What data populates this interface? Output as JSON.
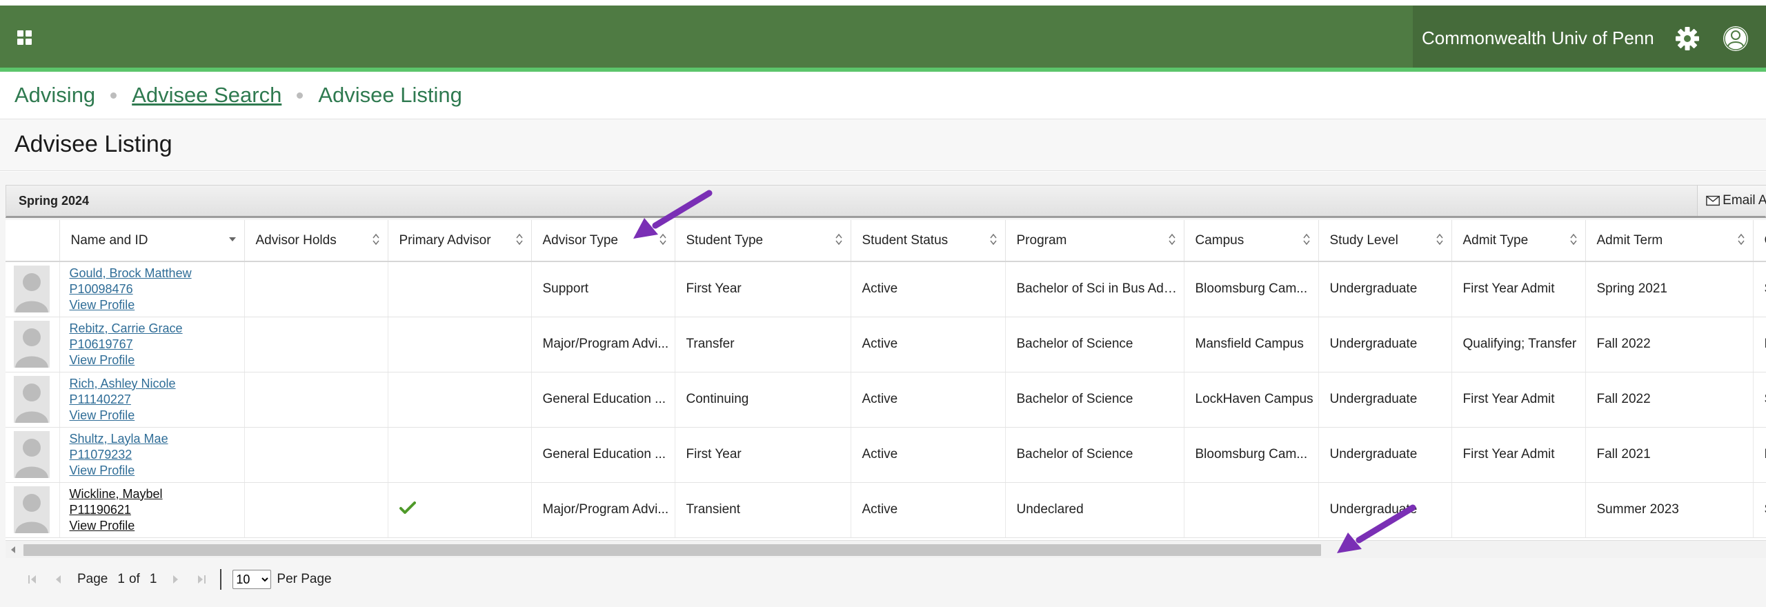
{
  "header": {
    "institution": "Commonwealth Univ of Penn",
    "icons": {
      "menu": "app-grid-icon",
      "settings": "gear-icon",
      "user": "user-circle-icon"
    },
    "bar_color": "#4f7b43",
    "accent_color": "#5cc56b"
  },
  "breadcrumb": [
    {
      "label": "Advising"
    },
    {
      "label": "Advisee Search"
    },
    {
      "label": "Advisee Listing"
    }
  ],
  "page": {
    "title": "Advisee Listing"
  },
  "grid": {
    "term": "Spring 2024",
    "email_all_label": "Email All",
    "columns": [
      "Name and ID",
      "Advisor Holds",
      "Primary Advisor",
      "Advisor Type",
      "Student Type",
      "Student Status",
      "Program",
      "Campus",
      "Study Level",
      "Admit Type",
      "Admit Term",
      "C"
    ],
    "rows": [
      {
        "name": "Gould, Brock Matthew",
        "id": "P10098476",
        "view_profile": "View Profile",
        "advisor_holds": "",
        "primary_advisor": false,
        "advisor_type": "Support",
        "student_type": "First Year",
        "student_status": "Active",
        "program": "Bachelor of Sci in Bus Admin",
        "campus": "Bloomsburg Cam...",
        "study_level": "Undergraduate",
        "admit_type": "First Year Admit",
        "admit_term": "Spring 2021",
        "c": "S"
      },
      {
        "name": "Rebitz, Carrie Grace",
        "id": "P10619767",
        "view_profile": "View Profile",
        "advisor_holds": "",
        "primary_advisor": false,
        "advisor_type": "Major/Program Advi...",
        "student_type": "Transfer",
        "student_status": "Active",
        "program": "Bachelor of Science",
        "campus": "Mansfield Campus",
        "study_level": "Undergraduate",
        "admit_type": "Qualifying; Transfer",
        "admit_term": "Fall 2022",
        "c": "F"
      },
      {
        "name": "Rich, Ashley Nicole",
        "id": "P11140227",
        "view_profile": "View Profile",
        "advisor_holds": "",
        "primary_advisor": false,
        "advisor_type": "General Education ...",
        "student_type": "Continuing",
        "student_status": "Active",
        "program": "Bachelor of Science",
        "campus": "LockHaven Campus",
        "study_level": "Undergraduate",
        "admit_type": "First Year Admit",
        "admit_term": "Fall 2022",
        "c": "S"
      },
      {
        "name": "Shultz, Layla Mae",
        "id": "P11079232",
        "view_profile": "View Profile",
        "advisor_holds": "",
        "primary_advisor": false,
        "advisor_type": "General Education ...",
        "student_type": "First Year",
        "student_status": "Active",
        "program": "Bachelor of Science",
        "campus": "Bloomsburg Cam...",
        "study_level": "Undergraduate",
        "admit_type": "First Year Admit",
        "admit_term": "Fall 2021",
        "c": "F"
      },
      {
        "name": "Wickline, Maybel",
        "id": "P11190621",
        "view_profile": "View Profile",
        "advisor_holds": "",
        "primary_advisor": true,
        "advisor_type": "Major/Program Advi...",
        "student_type": "Transient",
        "student_status": "Active",
        "program": "Undeclared",
        "campus": "",
        "study_level": "Undergraduate",
        "admit_type": "",
        "admit_term": "Summer 2023",
        "c": "S"
      }
    ]
  },
  "pager": {
    "page_label": "Page",
    "current_page": "1",
    "of_label": "of",
    "total_pages": "1",
    "per_page_value": "10",
    "per_page_label": "Per Page"
  },
  "annotation_color": "#7a2fb5"
}
